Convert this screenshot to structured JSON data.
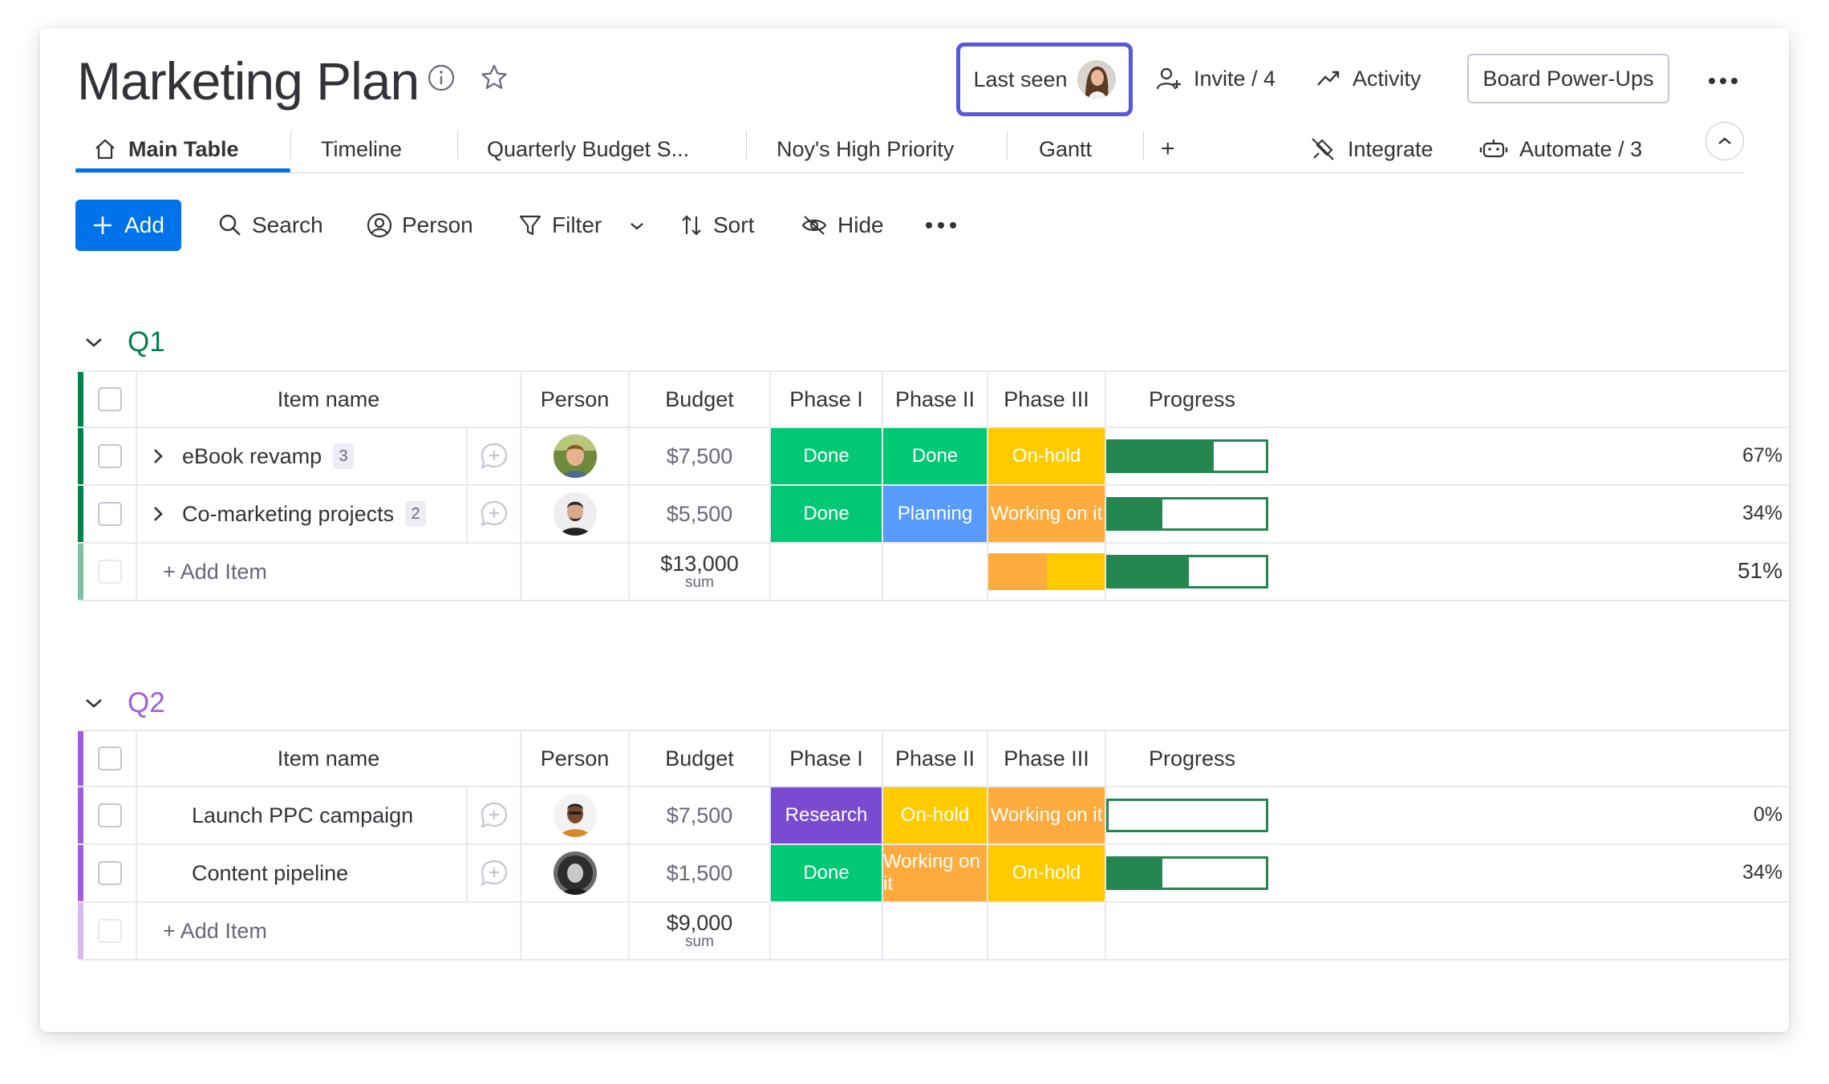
{
  "board": {
    "title": "Marketing Plan",
    "last_seen_label": "Last seen",
    "invite_label": "Invite / 4",
    "activity_label": "Activity",
    "powerups_label": "Board Power-Ups"
  },
  "tabs": [
    {
      "label": "Main Table",
      "active": true
    },
    {
      "label": "Timeline"
    },
    {
      "label": "Quarterly Budget S..."
    },
    {
      "label": "Noy's High Priority"
    },
    {
      "label": "Gantt"
    },
    {
      "label": "+"
    }
  ],
  "integrations": {
    "integrate_label": "Integrate",
    "automate_label": "Automate / 3"
  },
  "toolbar": {
    "add_label": "Add",
    "search_label": "Search",
    "person_label": "Person",
    "filter_label": "Filter",
    "sort_label": "Sort",
    "hide_label": "Hide"
  },
  "columns": {
    "item": "Item name",
    "person": "Person",
    "budget": "Budget",
    "phase1": "Phase I",
    "phase2": "Phase II",
    "phase3": "Phase III",
    "progress": "Progress"
  },
  "colors": {
    "accent": "#0073ea",
    "q1": "#037f4c",
    "q2": "#a25ddc",
    "done": "#00c875",
    "planning": "#579bfc",
    "onhold": "#ffcb00",
    "working": "#fdab3d",
    "research": "#784bd1",
    "progress": "#258750"
  },
  "groups": [
    {
      "name": "Q1",
      "rows": [
        {
          "name": "eBook revamp",
          "subitems": "3",
          "budget": "$7,500",
          "phase1": "Done",
          "phase2": "Done",
          "phase3": "On-hold",
          "progress": "67%"
        },
        {
          "name": "Co-marketing projects",
          "subitems": "2",
          "budget": "$5,500",
          "phase1": "Done",
          "phase2": "Planning",
          "phase3": "Working on it",
          "progress": "34%"
        }
      ],
      "add_item_label": "+ Add Item",
      "sum_value": "$13,000",
      "sum_label": "sum",
      "progress_total": "51%"
    },
    {
      "name": "Q2",
      "rows": [
        {
          "name": "Launch PPC campaign",
          "budget": "$7,500",
          "phase1": "Research",
          "phase2": "On-hold",
          "phase3": "Working on it",
          "progress": "0%"
        },
        {
          "name": "Content pipeline",
          "budget": "$1,500",
          "phase1": "Done",
          "phase2": "Working on it",
          "phase3": "On-hold",
          "progress": "34%"
        }
      ],
      "add_item_label": "+ Add Item",
      "sum_value": "$9,000",
      "sum_label": "sum"
    }
  ]
}
